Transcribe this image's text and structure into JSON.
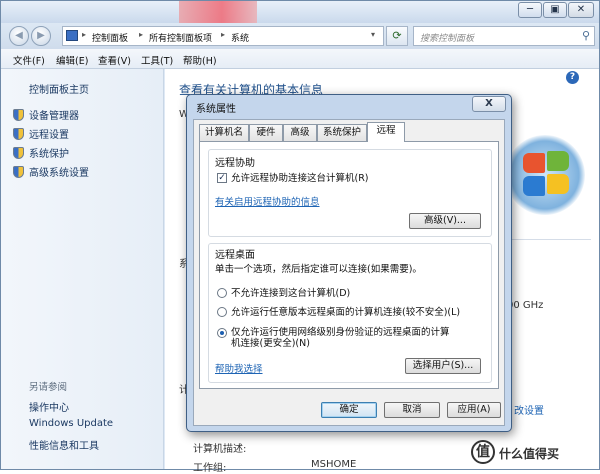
{
  "window": {
    "buttons": [
      "─",
      "▣",
      "✕"
    ]
  },
  "nav": {
    "breadcrumbs": [
      "控制面板",
      "所有控制面板项",
      "系统"
    ],
    "search_placeholder": "搜索控制面板"
  },
  "menubar": [
    "文件(F)",
    "编辑(E)",
    "查看(V)",
    "工具(T)",
    "帮助(H)"
  ],
  "left_pane": {
    "home": "控制面板主页",
    "items": [
      "设备管理器",
      "远程设置",
      "系统保护",
      "高级系统设置"
    ],
    "see_also_title": "另请参阅",
    "see_also": [
      "操作中心",
      "Windows Update",
      "性能信息和工具"
    ]
  },
  "right_pane": {
    "heading": "查看有关计算机的基本信息",
    "fragments": {
      "w": "Wi",
      "sys": "系统",
      "ghz": "00 GHz",
      "comp": "计算",
      "desc": "计算机描述:",
      "group_label": "工作组:",
      "group_value": "MSHOME",
      "settings_link": "改设置"
    }
  },
  "dialog": {
    "title": "系统属性",
    "close": "X",
    "tabs": [
      "计算机名",
      "硬件",
      "高级",
      "系统保护",
      "远程"
    ],
    "active_tab": 4,
    "remote_assist": {
      "title": "远程协助",
      "checkbox_label": "允许远程协助连接这台计算机(R)",
      "checked": true,
      "link": "有关启用远程协助的信息",
      "advanced_button": "高级(V)..."
    },
    "remote_desktop": {
      "title": "远程桌面",
      "description": "单击一个选项，然后指定谁可以连接(如果需要)。",
      "options": [
        "不允许连接到这台计算机(D)",
        "允许运行任意版本远程桌面的计算机连接(较不安全)(L)",
        "仅允许运行使用网络级别身份验证的远程桌面的计算",
        "机连接(更安全)(N)"
      ],
      "selected": 2,
      "help_link": "帮助我选择",
      "select_users_button": "选择用户(S)..."
    },
    "buttons": {
      "ok": "确定",
      "cancel": "取消",
      "apply": "应用(A)"
    }
  },
  "watermark": {
    "icon": "值",
    "text": "什么值得买"
  }
}
